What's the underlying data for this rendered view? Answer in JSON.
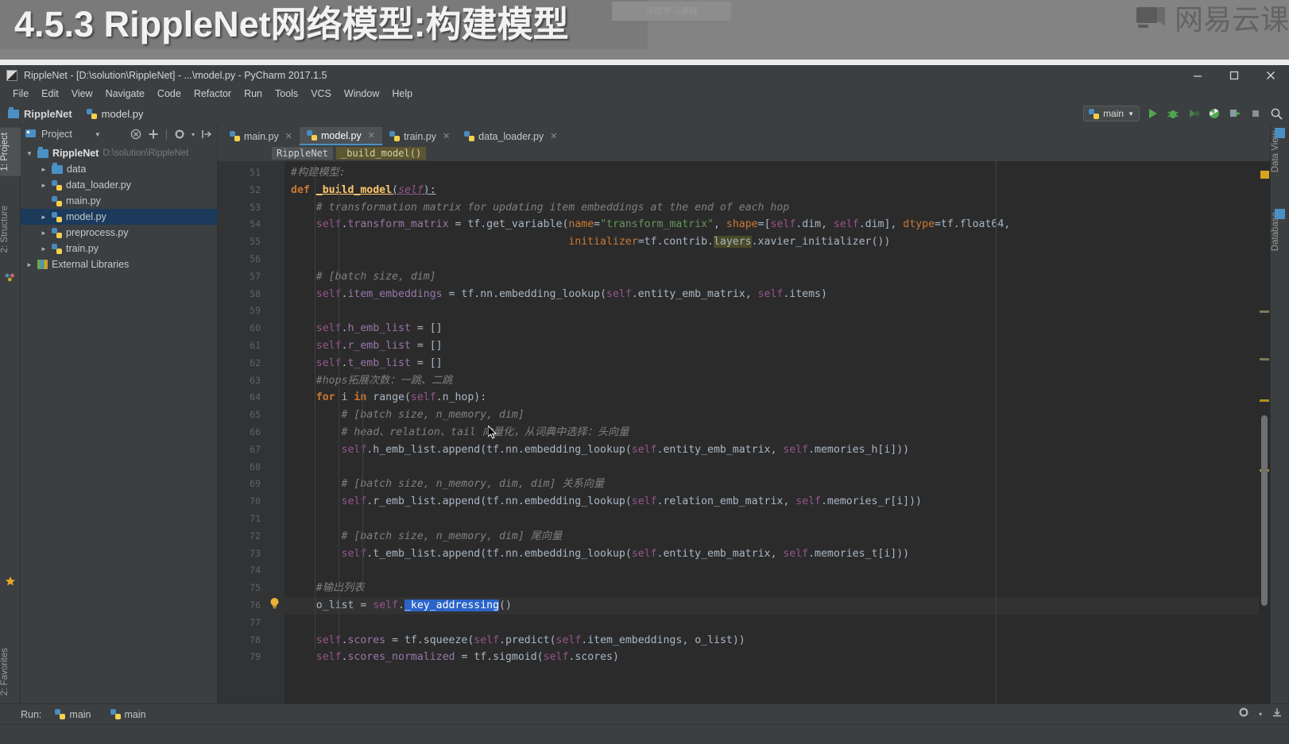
{
  "slide": {
    "title": "4.5.3 RippleNet网络模型:构建模型",
    "ghost_text": "深度学习课程",
    "brand": "网易云课",
    "brand_icon": "book-logo-icon"
  },
  "window": {
    "title": "RippleNet - [D:\\solution\\RippleNet] - ...\\model.py - PyCharm 2017.1.5",
    "controls": {
      "minimize": "minimize-icon",
      "maximize": "maximize-icon",
      "close": "close-icon"
    }
  },
  "menubar": {
    "items": [
      "File",
      "Edit",
      "View",
      "Navigate",
      "Code",
      "Refactor",
      "Run",
      "Tools",
      "VCS",
      "Window",
      "Help"
    ]
  },
  "navbar": {
    "crumbs": [
      {
        "label": "RippleNet",
        "icon": "folder-icon"
      },
      {
        "label": "model.py",
        "icon": "python-file-icon"
      }
    ],
    "run_config": {
      "label": "main",
      "icon": "python-file-icon",
      "chevron": "chevron-down-icon"
    },
    "buttons": [
      {
        "name": "run-button",
        "icon": "run-triangle-icon",
        "color": "#4fa84f"
      },
      {
        "name": "debug-button",
        "icon": "debug-bug-icon",
        "color": "#4fa84f"
      },
      {
        "name": "run-with-coverage-button",
        "icon": "run-coverage-icon",
        "color": "#5a7a5a"
      },
      {
        "name": "profile-button",
        "icon": "profile-pie-icon",
        "color": "#4fa84f"
      },
      {
        "name": "attach-button",
        "icon": "attach-process-icon",
        "color": "#9aa0a6"
      },
      {
        "name": "stop-button",
        "icon": "stop-square-icon",
        "color": "#9a9a9a"
      },
      {
        "name": "search-button",
        "icon": "search-icon",
        "color": "#c6c6c6"
      }
    ]
  },
  "left_strip": {
    "tabs": [
      {
        "label": "1: Project",
        "active": true,
        "icon": "project-icon"
      },
      {
        "label": "2: Structure",
        "active": false,
        "icon": "structure-icon"
      },
      {
        "label": "2: Favorites",
        "active": false,
        "icon": "favorites-star-icon"
      }
    ]
  },
  "right_strip": {
    "tabs": [
      {
        "label": "Data View",
        "icon": "data-view-icon"
      },
      {
        "label": "Database",
        "icon": "database-icon"
      }
    ]
  },
  "project_panel": {
    "header": {
      "title": "Project",
      "chevron": "chevron-down-icon",
      "icons": [
        "collapse-all-icon",
        "expand-all-icon",
        "settings-gear-icon",
        "hide-panel-icon"
      ]
    },
    "tree": [
      {
        "label": "RippleNet",
        "path": "D:\\solution\\RippleNet",
        "icon": "folder-icon",
        "arrow": "▼",
        "depth": 0,
        "bold": true,
        "selected": false
      },
      {
        "label": "data",
        "path": "",
        "icon": "folder-icon",
        "arrow": "►",
        "depth": 1,
        "bold": false,
        "selected": false
      },
      {
        "label": "data_loader.py",
        "path": "",
        "icon": "python-file-icon",
        "arrow": "►",
        "depth": 1,
        "bold": false,
        "selected": false
      },
      {
        "label": "main.py",
        "path": "",
        "icon": "python-file-icon",
        "arrow": "",
        "depth": 1,
        "bold": false,
        "selected": false
      },
      {
        "label": "model.py",
        "path": "",
        "icon": "python-file-icon",
        "arrow": "►",
        "depth": 1,
        "bold": false,
        "selected": true
      },
      {
        "label": "preprocess.py",
        "path": "",
        "icon": "python-file-icon",
        "arrow": "►",
        "depth": 1,
        "bold": false,
        "selected": false
      },
      {
        "label": "train.py",
        "path": "",
        "icon": "python-file-icon",
        "arrow": "►",
        "depth": 1,
        "bold": false,
        "selected": false
      },
      {
        "label": "External Libraries",
        "path": "",
        "icon": "library-icon",
        "arrow": "►",
        "depth": 0,
        "bold": false,
        "selected": false
      }
    ]
  },
  "editor": {
    "tabs": [
      {
        "label": "main.py",
        "active": false,
        "icon": "python-file-icon",
        "close": "close-icon"
      },
      {
        "label": "model.py",
        "active": true,
        "icon": "python-file-icon",
        "close": "close-icon"
      },
      {
        "label": "train.py",
        "active": false,
        "icon": "python-file-icon",
        "close": "close-icon"
      },
      {
        "label": "data_loader.py",
        "active": false,
        "icon": "python-file-icon",
        "close": "close-icon"
      }
    ],
    "breadcrumbs": [
      {
        "label": "RippleNet",
        "kind": "class"
      },
      {
        "label": "_build_model()",
        "kind": "function"
      }
    ],
    "first_line_number": 51,
    "last_line_number": 79,
    "selected_token": "_key_addressing",
    "intention_bulb_line": 76,
    "lines": [
      {
        "n": 51,
        "text": "#构建模型:"
      },
      {
        "n": 52,
        "text": "def _build_model(self):",
        "fold": "minus"
      },
      {
        "n": 53,
        "text": "    # transformation matrix for updating item embeddings at the end of each hop"
      },
      {
        "n": 54,
        "text": "    self.transform_matrix = tf.get_variable(name=\"transform_matrix\", shape=[self.dim, self.dim], dtype=tf.float64,"
      },
      {
        "n": 55,
        "text": "                                            initializer=tf.contrib.layers.xavier_initializer())"
      },
      {
        "n": 56,
        "text": ""
      },
      {
        "n": 57,
        "text": "    # [batch size, dim]"
      },
      {
        "n": 58,
        "text": "    self.item_embeddings = tf.nn.embedding_lookup(self.entity_emb_matrix, self.items)"
      },
      {
        "n": 59,
        "text": ""
      },
      {
        "n": 60,
        "text": "    self.h_emb_list = []"
      },
      {
        "n": 61,
        "text": "    self.r_emb_list = []"
      },
      {
        "n": 62,
        "text": "    self.t_emb_list = []"
      },
      {
        "n": 63,
        "text": "    #hops拓展次数：一跳、二跳"
      },
      {
        "n": 64,
        "text": "    for i in range(self.n_hop):",
        "fold": "minus"
      },
      {
        "n": 65,
        "text": "        # [batch size, n_memory, dim]",
        "fold": "minus"
      },
      {
        "n": 66,
        "text": "        # head、relation、tail 向量化，从词典中选择：头向量",
        "fold": "minus"
      },
      {
        "n": 67,
        "text": "        self.h_emb_list.append(tf.nn.embedding_lookup(self.entity_emb_matrix, self.memories_h[i]))"
      },
      {
        "n": 68,
        "text": ""
      },
      {
        "n": 69,
        "text": "        # [batch size, n_memory, dim, dim] 关系向量"
      },
      {
        "n": 70,
        "text": "        self.r_emb_list.append(tf.nn.embedding_lookup(self.relation_emb_matrix, self.memories_r[i]))"
      },
      {
        "n": 71,
        "text": ""
      },
      {
        "n": 72,
        "text": "        # [batch size, n_memory, dim] 尾向量"
      },
      {
        "n": 73,
        "text": "        self.t_emb_list.append(tf.nn.embedding_lookup(self.entity_emb_matrix, self.memories_t[i]))",
        "fold": "minus"
      },
      {
        "n": 74,
        "text": ""
      },
      {
        "n": 75,
        "text": "    #输出列表"
      },
      {
        "n": 76,
        "text": "    o_list = self._key_addressing()"
      },
      {
        "n": 77,
        "text": ""
      },
      {
        "n": 78,
        "text": "    self.scores = tf.squeeze(self.predict(self.item_embeddings, o_list))"
      },
      {
        "n": 79,
        "text": "    self.scores_normalized = tf.sigmoid(self.scores)",
        "fold": "minus"
      }
    ]
  },
  "bottombar": {
    "label": "Run:",
    "tabs": [
      {
        "label": "main",
        "icon": "python-file-icon"
      },
      {
        "label": "main",
        "icon": "python-file-icon"
      }
    ],
    "right_icons": [
      "settings-gear-icon",
      "hide-panel-icon"
    ]
  },
  "colors": {
    "editor_bg": "#2b2b2b",
    "chrome_bg": "#3c3f41",
    "gutter_bg": "#313335",
    "selection_blue": "#2a64c8",
    "tree_selected": "#1b3a5c",
    "accent_green": "#4fa84f",
    "keyword_orange": "#cc7832",
    "string_green": "#6a8759",
    "attr_purple": "#9876aa",
    "comment_gray": "#808080",
    "func_yellow": "#ffc66d",
    "plain_text": "#a9b7c6"
  }
}
